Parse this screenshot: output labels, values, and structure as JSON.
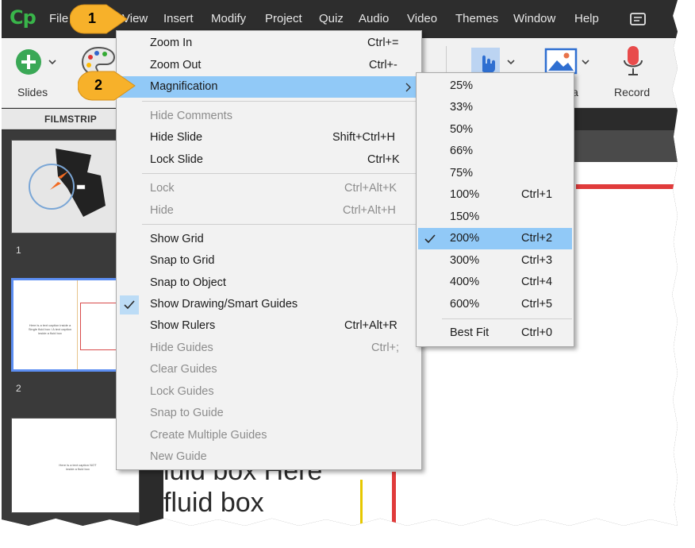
{
  "app": {
    "logo": "Cp"
  },
  "menubar": [
    {
      "label": "File"
    },
    {
      "label": "View"
    },
    {
      "label": "Insert"
    },
    {
      "label": "Modify"
    },
    {
      "label": "Project"
    },
    {
      "label": "Quiz"
    },
    {
      "label": "Audio"
    },
    {
      "label": "Video"
    },
    {
      "label": "Themes"
    },
    {
      "label": "Window"
    },
    {
      "label": "Help"
    }
  ],
  "toolbar": {
    "slides_label": "Slides",
    "media_label_partial": "ia",
    "record_label": "Record"
  },
  "filmstrip": {
    "header": "FILMSTRIP",
    "slides": [
      {
        "number": "1"
      },
      {
        "number": "2",
        "text": "Here is a text caption inside a Single fluid box / A text caption inside a fluid box"
      },
      {
        "text": "Here is a text caption NOT inside a fluid box"
      }
    ]
  },
  "stage": {
    "text_line1": "luid box Here",
    "text_line2": "fluid box"
  },
  "view_menu": [
    {
      "label": "Zoom In",
      "shortcut": "Ctrl+=",
      "disabled": false
    },
    {
      "label": "Zoom Out",
      "shortcut": "Ctrl+-",
      "disabled": false
    },
    {
      "label": "Magnification",
      "shortcut": "",
      "disabled": false,
      "submenu": true,
      "highlighted": true
    },
    {
      "separator": true
    },
    {
      "label": "Hide Comments",
      "shortcut": "",
      "disabled": true
    },
    {
      "label": "Hide Slide",
      "shortcut": "Shift+Ctrl+H",
      "disabled": false
    },
    {
      "label": "Lock Slide",
      "shortcut": "Ctrl+K",
      "disabled": false
    },
    {
      "separator": true
    },
    {
      "label": "Lock",
      "shortcut": "Ctrl+Alt+K",
      "disabled": true
    },
    {
      "label": "Hide",
      "shortcut": "Ctrl+Alt+H",
      "disabled": true
    },
    {
      "separator": true
    },
    {
      "label": "Show Grid",
      "shortcut": "",
      "disabled": false
    },
    {
      "label": "Snap to Grid",
      "shortcut": "",
      "disabled": false
    },
    {
      "label": "Snap to Object",
      "shortcut": "",
      "disabled": false
    },
    {
      "label": "Show Drawing/Smart Guides",
      "shortcut": "",
      "disabled": false,
      "checked": true
    },
    {
      "label": "Show Rulers",
      "shortcut": "Ctrl+Alt+R",
      "disabled": false
    },
    {
      "label": "Hide Guides",
      "shortcut": "Ctrl+;",
      "disabled": true
    },
    {
      "label": "Clear Guides",
      "shortcut": "",
      "disabled": true
    },
    {
      "label": "Lock Guides",
      "shortcut": "",
      "disabled": true
    },
    {
      "label": "Snap to Guide",
      "shortcut": "",
      "disabled": true
    },
    {
      "label": "Create Multiple Guides",
      "shortcut": "",
      "disabled": true
    },
    {
      "label": "New Guide",
      "shortcut": "",
      "disabled": true
    }
  ],
  "magnification_menu": [
    {
      "label": "25%",
      "shortcut": ""
    },
    {
      "label": "33%",
      "shortcut": ""
    },
    {
      "label": "50%",
      "shortcut": ""
    },
    {
      "label": "66%",
      "shortcut": ""
    },
    {
      "label": "75%",
      "shortcut": ""
    },
    {
      "label": "100%",
      "shortcut": "Ctrl+1"
    },
    {
      "label": "150%",
      "shortcut": ""
    },
    {
      "label": "200%",
      "shortcut": "Ctrl+2",
      "checked": true,
      "highlighted": true
    },
    {
      "label": "300%",
      "shortcut": "Ctrl+3"
    },
    {
      "label": "400%",
      "shortcut": "Ctrl+4"
    },
    {
      "label": "600%",
      "shortcut": "Ctrl+5"
    },
    {
      "separator": true
    },
    {
      "label": "Best Fit",
      "shortcut": "Ctrl+0"
    }
  ],
  "callouts": [
    {
      "label": "1"
    },
    {
      "label": "2"
    }
  ],
  "colors": {
    "highlight": "#91c9f7",
    "callout": "#f7b12a",
    "logo": "#39b54a",
    "record": "#e84b4b"
  }
}
